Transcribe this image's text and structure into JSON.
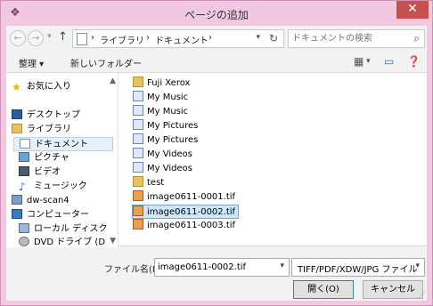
{
  "window": {
    "title": "ページの追加",
    "close_symbol": "✕",
    "app_icon": "scanner-icon"
  },
  "addressbar": {
    "crumbs": [
      "ライブラリ",
      "ドキュメント"
    ],
    "separator": "›",
    "search_placeholder": "ドキュメントの検索"
  },
  "toolbar": {
    "organize_label": "整理 ▾",
    "new_folder_label": "新しいフォルダー"
  },
  "sidebar": {
    "items": [
      {
        "label": "お気に入り",
        "icon": "star-icon"
      },
      {
        "label": "デスクトップ",
        "icon": "desktop-icon"
      },
      {
        "label": "ライブラリ",
        "icon": "library-icon"
      },
      {
        "label": "ドキュメント",
        "icon": "document-icon",
        "selected": true
      },
      {
        "label": "ピクチャ",
        "icon": "pictures-icon"
      },
      {
        "label": "ビデオ",
        "icon": "video-icon"
      },
      {
        "label": "ミュージック",
        "icon": "music-icon"
      },
      {
        "label": "dw-scan4",
        "icon": "user-folder-icon"
      },
      {
        "label": "コンピューター",
        "icon": "computer-icon"
      },
      {
        "label": "ローカル ディスク",
        "icon": "local-disk-icon"
      },
      {
        "label": "DVD ドライブ (D:",
        "icon": "dvd-drive-icon"
      }
    ]
  },
  "files": [
    {
      "name": "Fuji Xerox",
      "icon": "folder-icon"
    },
    {
      "name": "My Music",
      "icon": "music-library-icon"
    },
    {
      "name": "My Music",
      "icon": "music-library-icon"
    },
    {
      "name": "My Pictures",
      "icon": "pictures-library-icon"
    },
    {
      "name": "My Pictures",
      "icon": "pictures-library-icon"
    },
    {
      "name": "My Videos",
      "icon": "videos-library-icon"
    },
    {
      "name": "My Videos",
      "icon": "videos-library-icon"
    },
    {
      "name": "test",
      "icon": "folder-icon"
    },
    {
      "name": "image0611-0001.tif",
      "icon": "tif-file-icon"
    },
    {
      "name": "image0611-0002.tif",
      "icon": "tif-file-icon",
      "selected": true
    },
    {
      "name": "image0611-0003.tif",
      "icon": "tif-file-icon"
    }
  ],
  "bottom": {
    "filename_label": "ファイル名(N):",
    "filename_value": "image0611-0002.tif",
    "filetype_value": "TIFF/PDF/XDW/JPG ファイル",
    "open_label": "開く(O)",
    "cancel_label": "キャンセル"
  }
}
